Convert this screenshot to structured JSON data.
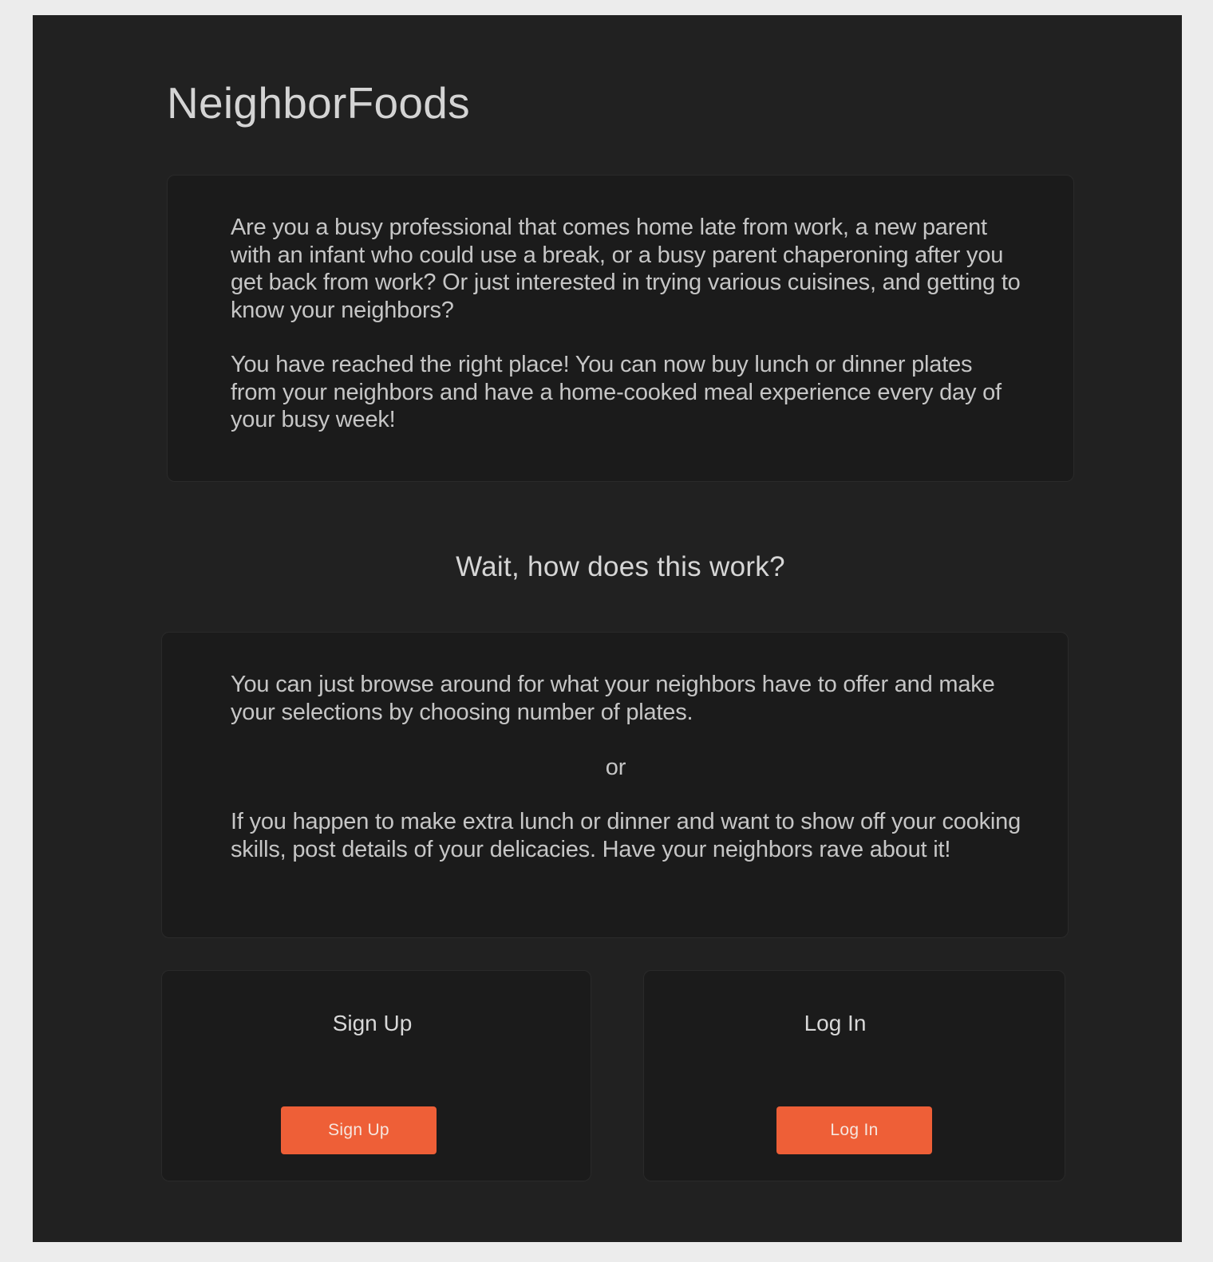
{
  "header": {
    "app_title": "NeighborFoods"
  },
  "intro": {
    "paragraph1": "Are you a busy professional that comes home late from work, a new parent with an infant who could use a break, or a busy parent chaperoning after you get back from work? Or just interested in trying various cuisines, and getting to know your neighbors?",
    "paragraph2": "You have reached the right place! You can now buy lunch or dinner plates from your neighbors and have a home-cooked meal experience every day of your busy week!"
  },
  "how_it_works": {
    "heading": "Wait, how does this work?",
    "paragraph1": "You can just browse around for what your neighbors have to offer and make your selections by choosing number of plates.",
    "separator": "or",
    "paragraph2": "If you happen to make extra lunch or dinner and want to show off your cooking skills, post details of your delicacies. Have your neighbors rave about it!"
  },
  "signup": {
    "title": "Sign Up",
    "button_label": "Sign Up"
  },
  "login": {
    "title": "Log In",
    "button_label": "Log In"
  },
  "colors": {
    "page_background": "#ececec",
    "frame_background": "#212121",
    "card_background": "#1b1b1b",
    "accent": "#ee5f37",
    "text": "#c6c6c6"
  }
}
